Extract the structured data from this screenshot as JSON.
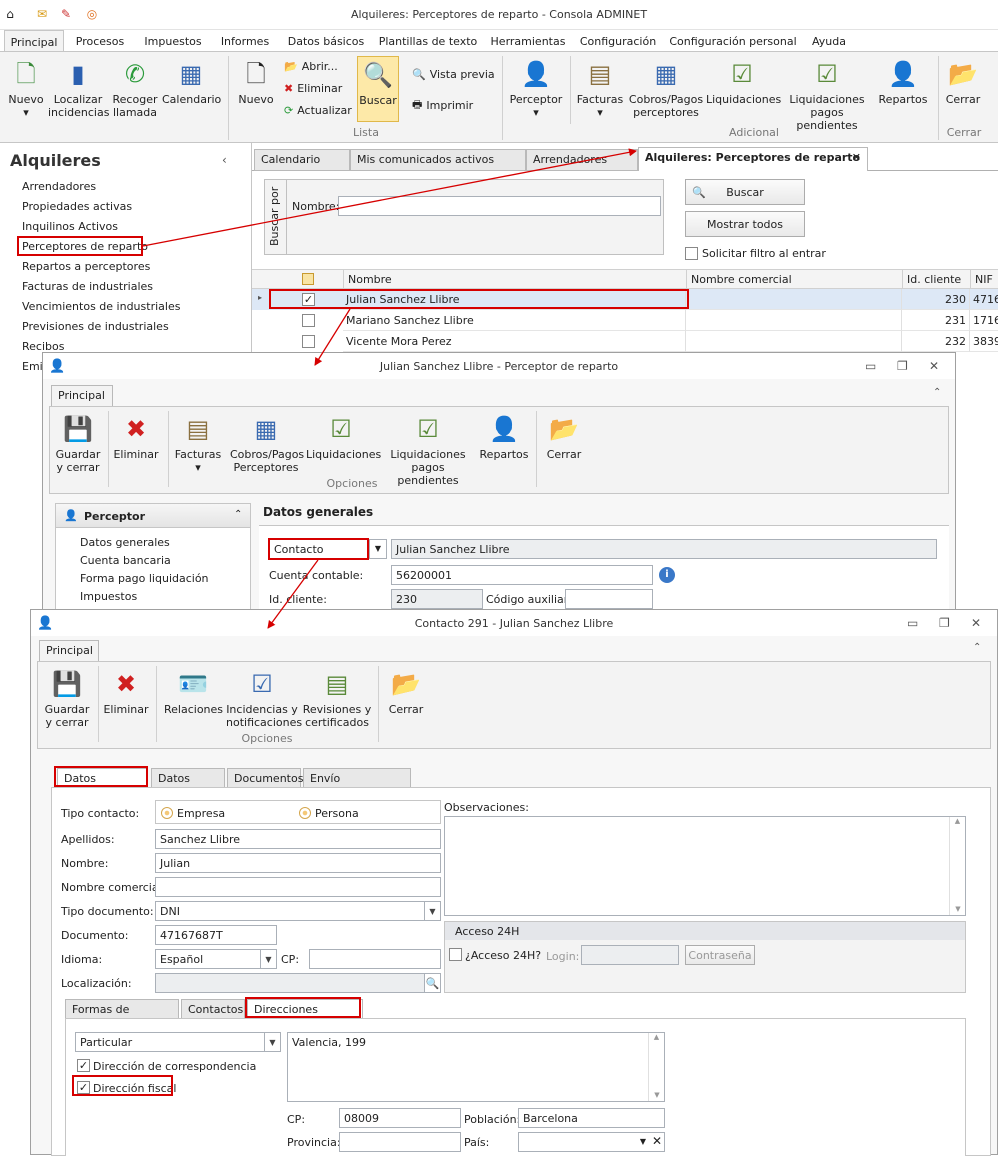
{
  "main": {
    "title": "Alquileres: Perceptores de reparto - Consola ADMINET",
    "tabs": [
      "Principal",
      "Procesos",
      "Impuestos",
      "Informes",
      "Datos básicos",
      "Plantillas de texto",
      "Herramientas",
      "Configuración",
      "Configuración personal",
      "Ayuda"
    ],
    "ribbon": {
      "nuevo": "Nuevo",
      "localizar": "Localizar incidencias",
      "recoger": "Recoger llamada",
      "calendario": "Calendario",
      "nuevo2": "Nuevo",
      "abrir": "Abrir...",
      "eliminar": "Eliminar",
      "actualizar": "Actualizar",
      "buscar": "Buscar",
      "vista_previa": "Vista previa",
      "imprimir": "Imprimir",
      "group_lista": "Lista",
      "perceptor": "Perceptor",
      "facturas": "Facturas",
      "cobros": "Cobros/Pagos perceptores",
      "liquidaciones": "Liquidaciones",
      "liq_pend": "Liquidaciones pagos pendientes",
      "repartos": "Repartos",
      "group_adicional": "Adicional",
      "cerrar": "Cerrar",
      "group_cerrar": "Cerrar"
    },
    "sidebar": {
      "title": "Alquileres",
      "items": [
        "Arrendadores",
        "Propiedades activas",
        "Inquilinos Activos",
        "Perceptores de reparto",
        "Repartos a perceptores",
        "Facturas de industriales",
        "Vencimientos de industriales",
        "Previsiones de industriales",
        "Recibos",
        "Emis"
      ]
    },
    "doc_tabs": [
      "Calendario",
      "Mis comunicados activos",
      "Arrendadores",
      "Alquileres: Perceptores de reparto"
    ],
    "filter": {
      "group": "Buscar por",
      "nombre_label": "Nombre:",
      "buscar": "Buscar",
      "mostrar": "Mostrar todos",
      "solicitar": "Solicitar filtro al entrar"
    },
    "grid": {
      "headers": [
        "Nombre",
        "Nombre comercial",
        "Id. cliente",
        "NIF"
      ],
      "rows": [
        {
          "nombre": "Julian Sanchez Llibre",
          "id": "230",
          "nif": "4716",
          "checked": true
        },
        {
          "nombre": "Mariano Sanchez Llibre",
          "id": "231",
          "nif": "1716",
          "checked": false
        },
        {
          "nombre": "Vicente Mora Perez",
          "id": "232",
          "nif": "3839",
          "checked": false
        }
      ]
    }
  },
  "perceptor": {
    "title": "Julian Sanchez Llibre - Perceptor de reparto",
    "tab": "Principal",
    "ribbon": {
      "guardar": "Guardar y cerrar",
      "eliminar": "Eliminar",
      "facturas": "Facturas",
      "cobros": "Cobros/Pagos Perceptores",
      "liquidaciones": "Liquidaciones",
      "liq_pend": "Liquidaciones pagos pendientes",
      "repartos": "Repartos",
      "cerrar": "Cerrar",
      "group": "Opciones"
    },
    "nav_title": "Perceptor",
    "nav_items": [
      "Datos generales",
      "Cuenta bancaria",
      "Forma pago liquidación",
      "Impuestos"
    ],
    "section": "Datos generales",
    "contacto_label": "Contacto",
    "contacto_value": "Julian Sanchez Llibre",
    "cuenta_label": "Cuenta contable:",
    "cuenta_value": "56200001",
    "id_label": "Id. cliente:",
    "id_value": "230",
    "aux_label": "Código auxiliar:"
  },
  "contacto": {
    "title": "Contacto 291 - Julian Sanchez Llibre",
    "tab": "Principal",
    "ribbon": {
      "guardar": "Guardar y cerrar",
      "eliminar": "Eliminar",
      "relaciones": "Relaciones",
      "incidencias": "Incidencias y notificaciones",
      "revisiones": "Revisiones y certificados",
      "cerrar": "Cerrar",
      "group": "Opciones"
    },
    "tabs": [
      "Datos generales",
      "Datos cliente",
      "Documentos",
      "Envío notificaciones"
    ],
    "tipo_label": "Tipo contacto:",
    "empresa": "Empresa",
    "persona": "Persona",
    "apellidos_label": "Apellidos:",
    "apellidos": "Sanchez Llibre",
    "nombre_label": "Nombre:",
    "nombre": "Julian",
    "comercial_label": "Nombre comercial:",
    "tipodoc_label": "Tipo documento:",
    "tipodoc": "DNI",
    "documento_label": "Documento:",
    "documento": "47167687T",
    "idioma_label": "Idioma:",
    "idioma": "Español",
    "cp_label": "CP:",
    "localizacion_label": "Localización:",
    "observaciones_label": "Observaciones:",
    "acceso_title": "Acceso 24H",
    "acceso_label": "¿Acceso 24H?",
    "login_label": "Login:",
    "contrasena": "Contraseña",
    "sub_tabs": [
      "Formas de contactar",
      "Contactos",
      "Direcciones postales"
    ],
    "dir_tipo": "Particular",
    "dir_corresp": "Dirección de correspondencia",
    "dir_fiscal": "Dirección fiscal",
    "direccion": "Valencia, 199",
    "cp_label2": "CP:",
    "cp": "08009",
    "poblacion_label": "Población:",
    "poblacion": "Barcelona",
    "provincia_label": "Provincia:",
    "pais_label": "País:"
  },
  "colors": {
    "accent": "#d60000",
    "ribbon": "#f3f3f3",
    "selected_row": "#dde8f6"
  }
}
